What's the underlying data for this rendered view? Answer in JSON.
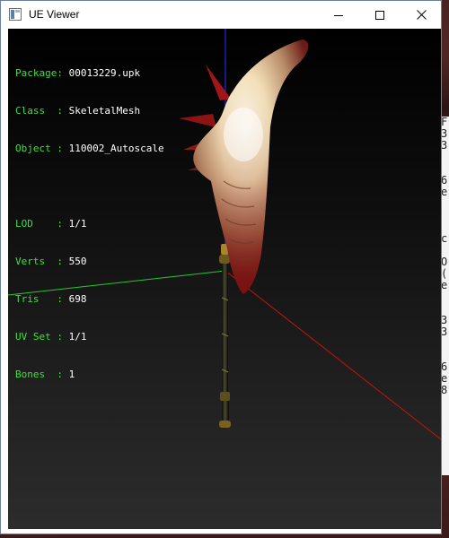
{
  "window": {
    "title": "UE Viewer",
    "icon": "app-icon",
    "controls": {
      "minimize_icon": "minimize-icon",
      "maximize_icon": "maximize-icon",
      "close_icon": "close-icon"
    }
  },
  "info": {
    "package": {
      "key": "Package: ",
      "value": "00013229.upk"
    },
    "class": {
      "key": "Class  : ",
      "value": "SkeletalMesh"
    },
    "object": {
      "key": "Object : ",
      "value": "110002_Autoscale"
    },
    "lod": {
      "key": "LOD    : ",
      "value": "1/1"
    },
    "verts": {
      "key": "Verts  : ",
      "value": "550"
    },
    "tris": {
      "key": "Tris   : ",
      "value": "698"
    },
    "uvset": {
      "key": "UV Set : ",
      "value": "1/1"
    },
    "bones": {
      "key": "Bones  : ",
      "value": "1"
    }
  },
  "colors": {
    "label": "#3ee03e",
    "value": "#ffffff",
    "axis_x": "#cc1111",
    "axis_y": "#22cc22",
    "axis_z": "#2233ff"
  },
  "background_window": {
    "partial_lines": [
      "F",
      "3",
      "3",
      "",
      "",
      "6",
      "e",
      "",
      "",
      "",
      "c",
      "",
      "O",
      "(",
      "e",
      "",
      "",
      "3",
      "3",
      "",
      "",
      "6",
      "e",
      "8"
    ]
  }
}
